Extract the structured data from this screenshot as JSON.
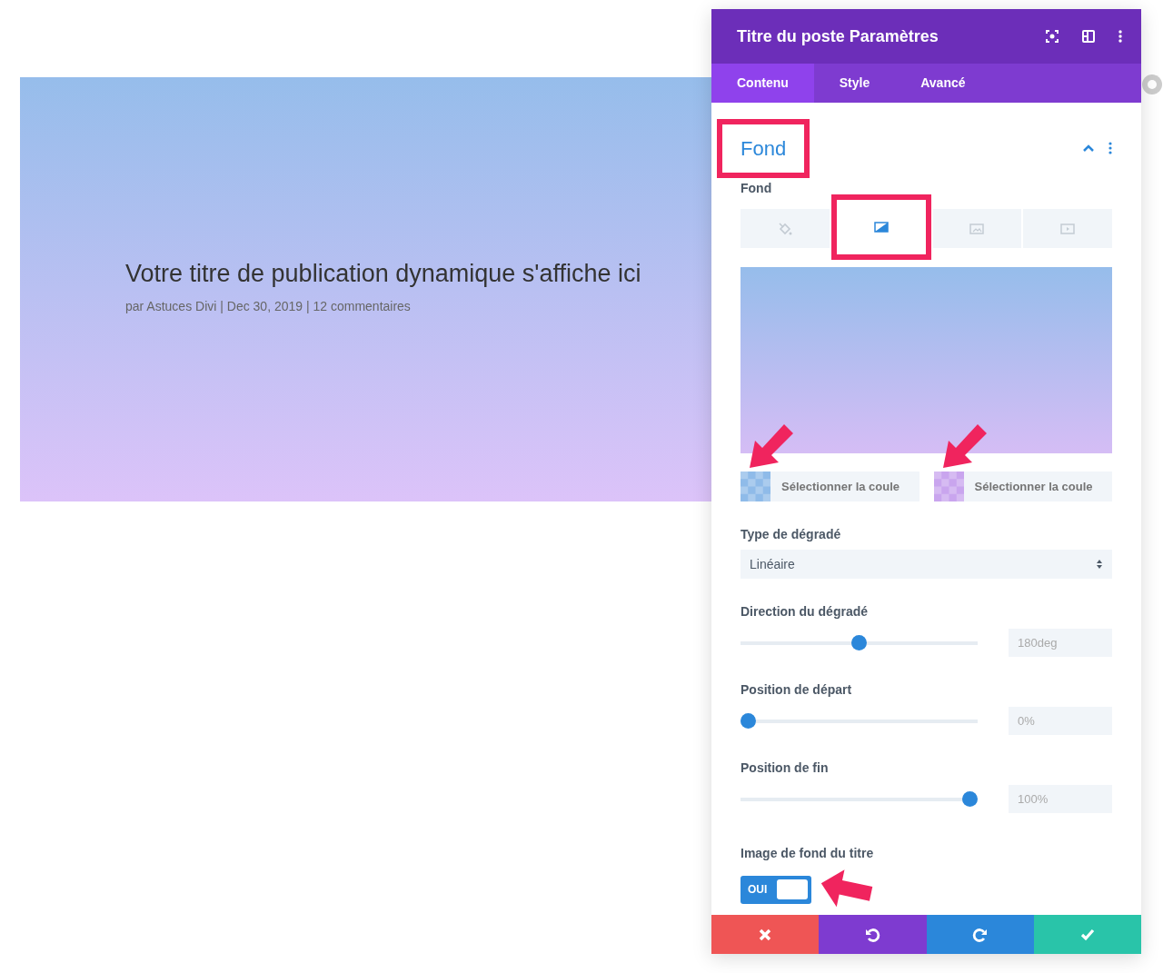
{
  "post": {
    "title": "Votre titre de publication dynamique s'affiche ici",
    "meta": "par Astuces Divi | Dec 30, 2019 | 12 commentaires"
  },
  "panel": {
    "title": "Titre du poste Paramètres",
    "tabs": [
      {
        "label": "Contenu",
        "selected": true
      },
      {
        "label": "Style",
        "selected": false
      },
      {
        "label": "Avancé",
        "selected": false
      }
    ],
    "section": {
      "title": "Fond",
      "highlighted": true,
      "expanded": true
    },
    "background": {
      "label": "Fond",
      "types": [
        {
          "kind": "color",
          "selected": false,
          "highlighted": false
        },
        {
          "kind": "gradient",
          "selected": true,
          "highlighted": true
        },
        {
          "kind": "image",
          "selected": false,
          "highlighted": false
        },
        {
          "kind": "video",
          "selected": false,
          "highlighted": false
        }
      ]
    },
    "gradient_colors": [
      {
        "color": "#8fbbe9",
        "placeholder": "Sélectionner la coule",
        "pointed": true
      },
      {
        "color": "#c9a5ee",
        "placeholder": "Sélectionner la coule",
        "pointed": true
      }
    ],
    "gradient_type": {
      "label": "Type de dégradé",
      "value": "Linéaire"
    },
    "sliders": [
      {
        "label": "Direction du dégradé",
        "level": 0.5,
        "reading": "180deg"
      },
      {
        "label": "Position de départ",
        "level": 0,
        "reading": "0%"
      },
      {
        "label": "Position de fin",
        "level": 1,
        "reading": "100%"
      }
    ],
    "toggle": {
      "label": "Image de fond du titre",
      "on": true,
      "text": "OUI",
      "pointed": true
    },
    "actions": [
      {
        "kind": "cancel"
      },
      {
        "kind": "undo"
      },
      {
        "kind": "redo"
      },
      {
        "kind": "save"
      }
    ]
  }
}
